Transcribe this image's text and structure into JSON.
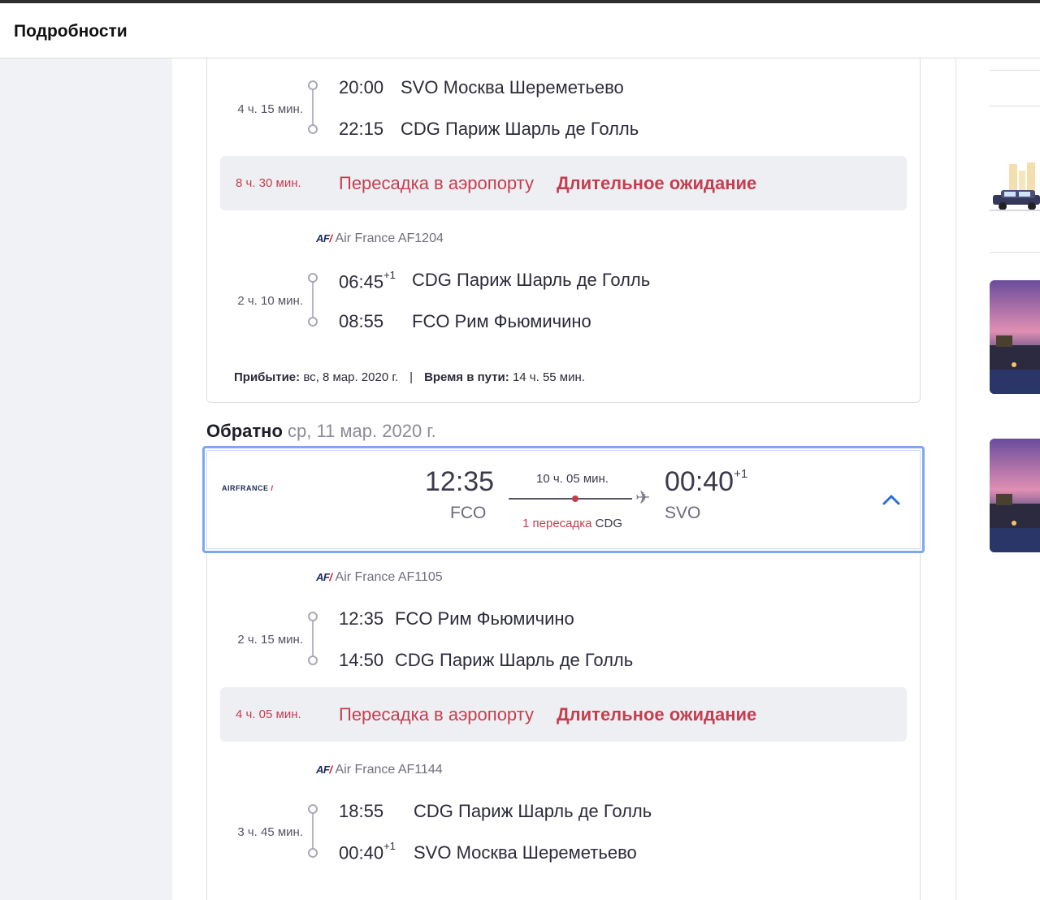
{
  "header": {
    "title": "Подробности"
  },
  "outbound": {
    "segment1": {
      "duration": "4 ч. 15 мин.",
      "dep_time": "20:00",
      "dep_airport": "SVO Москва Шереметьево",
      "arr_time": "22:15",
      "arr_airport": "CDG Париж Шарль де Голль"
    },
    "layover": {
      "duration": "8 ч. 30 мин.",
      "text": "Пересадка в аэропорту",
      "warning": "Длительное ожидание"
    },
    "segment2": {
      "carrier": "Air France AF1204",
      "duration": "2 ч. 10 мин.",
      "dep_time": "06:45",
      "dep_plus": "+1",
      "dep_airport": "CDG Париж Шарль де Голль",
      "arr_time": "08:55",
      "arr_airport": "FCO Рим Фьюмичино"
    },
    "arrival_label": "Прибытие:",
    "arrival_value": "вс, 8 мар. 2020 г.",
    "separator": "|",
    "travel_label": "Время в пути:",
    "travel_value": "14 ч. 55 мин."
  },
  "return": {
    "title": "Обратно",
    "date": "ср, 11 мар. 2020 г.",
    "summary": {
      "airline_logo": "AIRFRANCE",
      "dep_time": "12:35",
      "dep_code": "FCO",
      "duration": "10 ч. 05 мин.",
      "stops": "1 пересадка",
      "stop_code": "CDG",
      "arr_time": "00:40",
      "arr_plus": "+1",
      "arr_code": "SVO"
    },
    "segment1": {
      "carrier": "Air France AF1105",
      "duration": "2 ч. 15 мин.",
      "dep_time": "12:35",
      "dep_airport": "FCO Рим Фьюмичино",
      "arr_time": "14:50",
      "arr_airport": "CDG Париж Шарль де Голль"
    },
    "layover": {
      "duration": "4 ч. 05 мин.",
      "text": "Пересадка в аэропорту",
      "warning": "Длительное ожидание"
    },
    "segment2": {
      "carrier": "Air France AF1144",
      "duration": "3 ч. 45 мин.",
      "dep_time": "18:55",
      "dep_airport": "CDG Париж Шарль де Голль",
      "arr_time": "00:40",
      "arr_plus": "+1",
      "arr_airport": "SVO Москва Шереметьево"
    }
  },
  "carrier_logo": {
    "mark": "AF",
    "slash": "/"
  },
  "colors": {
    "alert": "#c53e4f",
    "focus": "#7fa7ee",
    "accent": "#2a6fdb"
  },
  "icons": {
    "plane": "plane-icon",
    "chevron": "chevron-up-icon"
  }
}
